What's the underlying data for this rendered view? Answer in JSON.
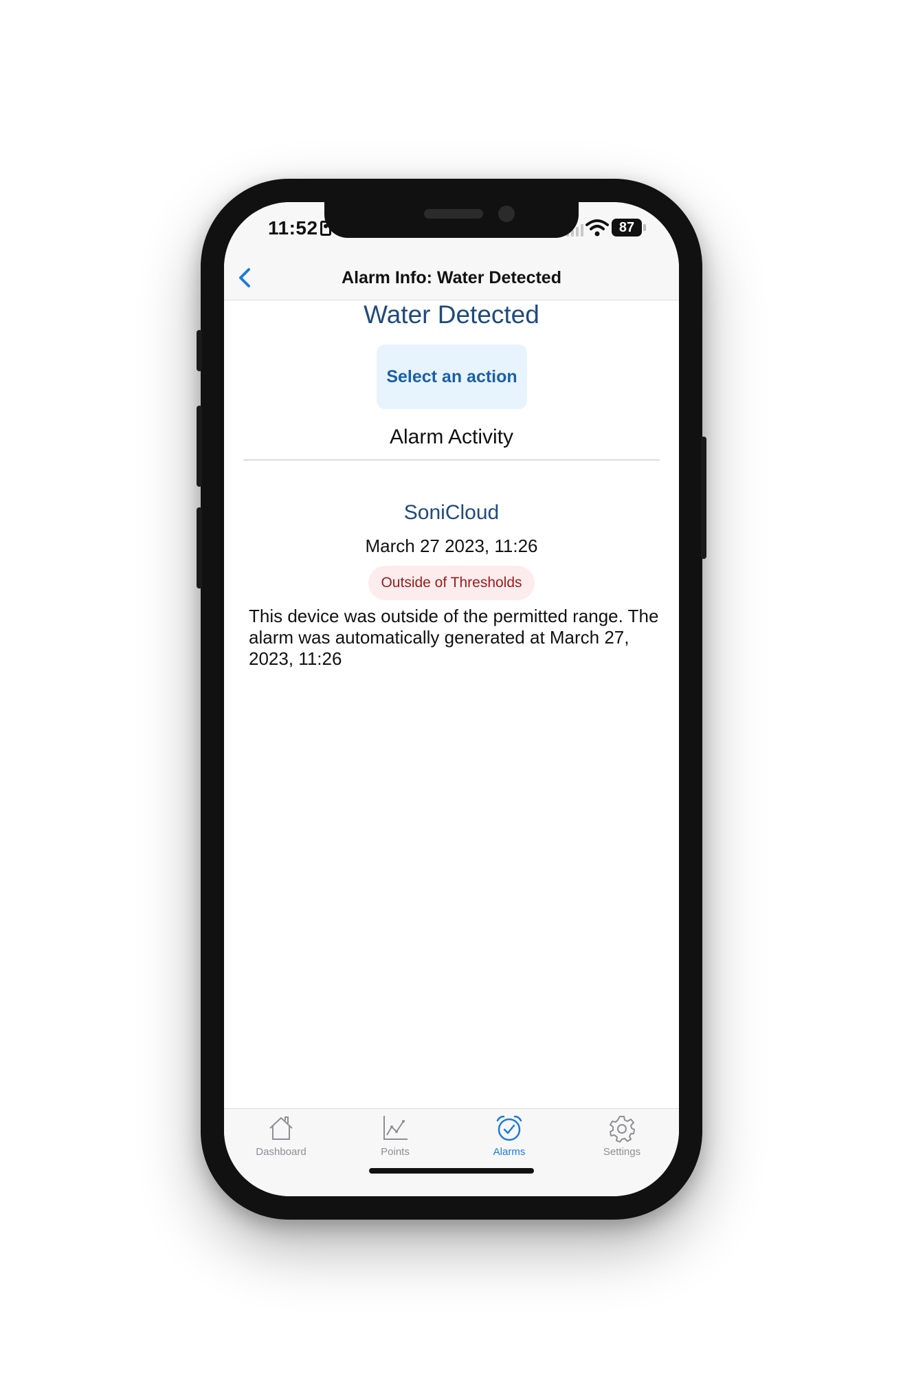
{
  "status_bar": {
    "time": "11:52",
    "battery": "87"
  },
  "nav": {
    "title": "Alarm Info: Water Detected"
  },
  "alarm": {
    "title": "Water Detected",
    "action_button": "Select an action",
    "activity_heading": "Alarm Activity"
  },
  "activity": {
    "source": "SoniCloud",
    "date": "March 27 2023, 11:26",
    "status": "Outside of Thresholds",
    "description": "This device was outside of the permitted range. The alarm was automatically generated at March 27, 2023, 11:26"
  },
  "tabs": [
    {
      "label": "Dashboard",
      "icon": "house-icon",
      "active": false
    },
    {
      "label": "Points",
      "icon": "chart-icon",
      "active": false
    },
    {
      "label": "Alarms",
      "icon": "alarm-clock-icon",
      "active": true
    },
    {
      "label": "Settings",
      "icon": "gear-icon",
      "active": false
    }
  ],
  "colors": {
    "accent": "#1a7be0",
    "title_blue": "#1f4a7c",
    "badge_text": "#9b1b1b",
    "badge_bg": "#fdeced",
    "button_bg": "#e8f4fd"
  }
}
